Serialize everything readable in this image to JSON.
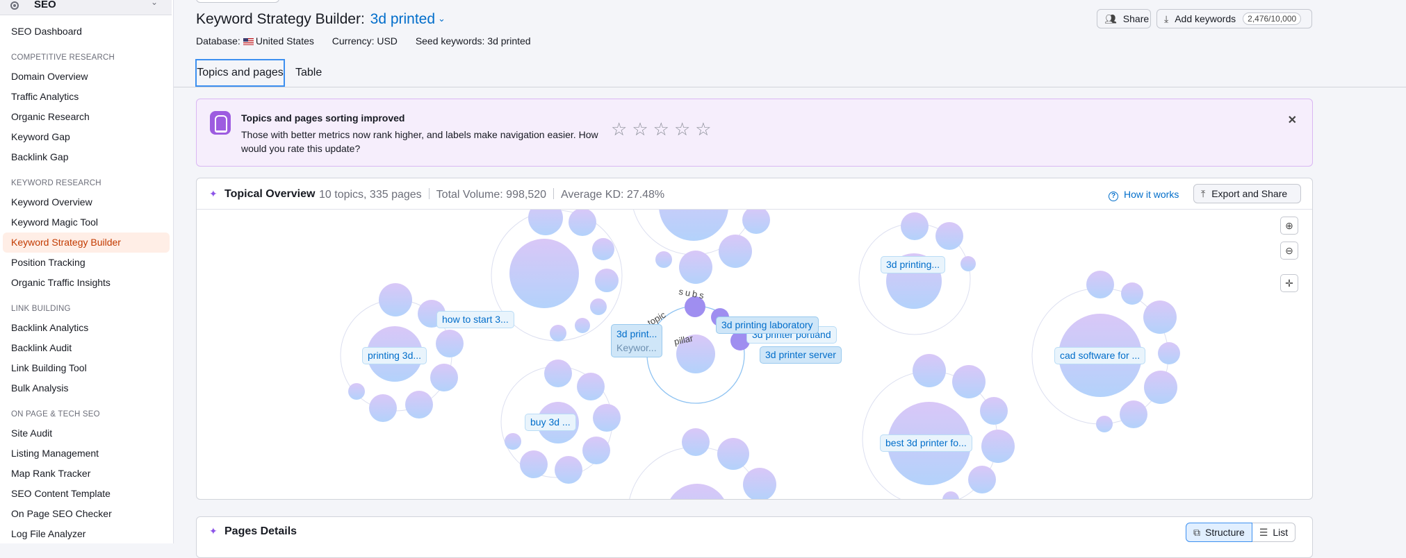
{
  "sidebar": {
    "top_label": "SEO",
    "dashboard": "SEO Dashboard",
    "sections": [
      {
        "title": "COMPETITIVE RESEARCH",
        "items": [
          "Domain Overview",
          "Traffic Analytics",
          "Organic Research",
          "Keyword Gap",
          "Backlink Gap"
        ]
      },
      {
        "title": "KEYWORD RESEARCH",
        "items": [
          "Keyword Overview",
          "Keyword Magic Tool",
          "Keyword Strategy Builder",
          "Position Tracking",
          "Organic Traffic Insights"
        ]
      },
      {
        "title": "LINK BUILDING",
        "items": [
          "Backlink Analytics",
          "Backlink Audit",
          "Link Building Tool",
          "Bulk Analysis"
        ]
      },
      {
        "title": "ON PAGE & TECH SEO",
        "items": [
          "Site Audit",
          "Listing Management",
          "Map Rank Tracker",
          "SEO Content Template",
          "On Page SEO Checker",
          "Log File Analyzer"
        ]
      }
    ]
  },
  "header": {
    "title": "Keyword Strategy Builder:",
    "title_link": "3d printed",
    "database_label": "Database:",
    "database_value": "United States",
    "currency": "Currency: USD",
    "seed": "Seed keywords: 3d printed",
    "share_label": "Share",
    "add_label": "Add keywords",
    "add_counter": "2,476/10,000"
  },
  "tabs": [
    "Topics and pages",
    "Table"
  ],
  "banner": {
    "title": "Topics and pages sorting improved",
    "text": "Those with better metrics now rank higher, and labels make navigation easier. How would you rate this update?",
    "close": "✕",
    "rating": 0,
    "rating_max": 5
  },
  "overview": {
    "title": "Topical Overview",
    "topics": "10 topics, 335 pages",
    "volume": "Total Volume: 998,520",
    "kd": "Average KD: 27.48%",
    "how": "How it works",
    "export": "Export and Share",
    "bubbles": [
      "how to start 3...",
      "3d printing...",
      "printing 3d...",
      "cad software for ...",
      "buy 3d ...",
      "best 3d printer fo...",
      "3d printing laboratory",
      "3d printer portland",
      "3d printer server"
    ],
    "center_title": "3d print...",
    "center_sub": "Keywor...",
    "arc_labels": [
      "topic",
      "subs",
      "pillar"
    ]
  },
  "pages_details": {
    "title": "Pages Details",
    "structure": "Structure",
    "list": "List"
  },
  "colors": {
    "accent": "#006dca",
    "active_nav": "#c23a00",
    "banner_bg": "#f6eefc"
  }
}
